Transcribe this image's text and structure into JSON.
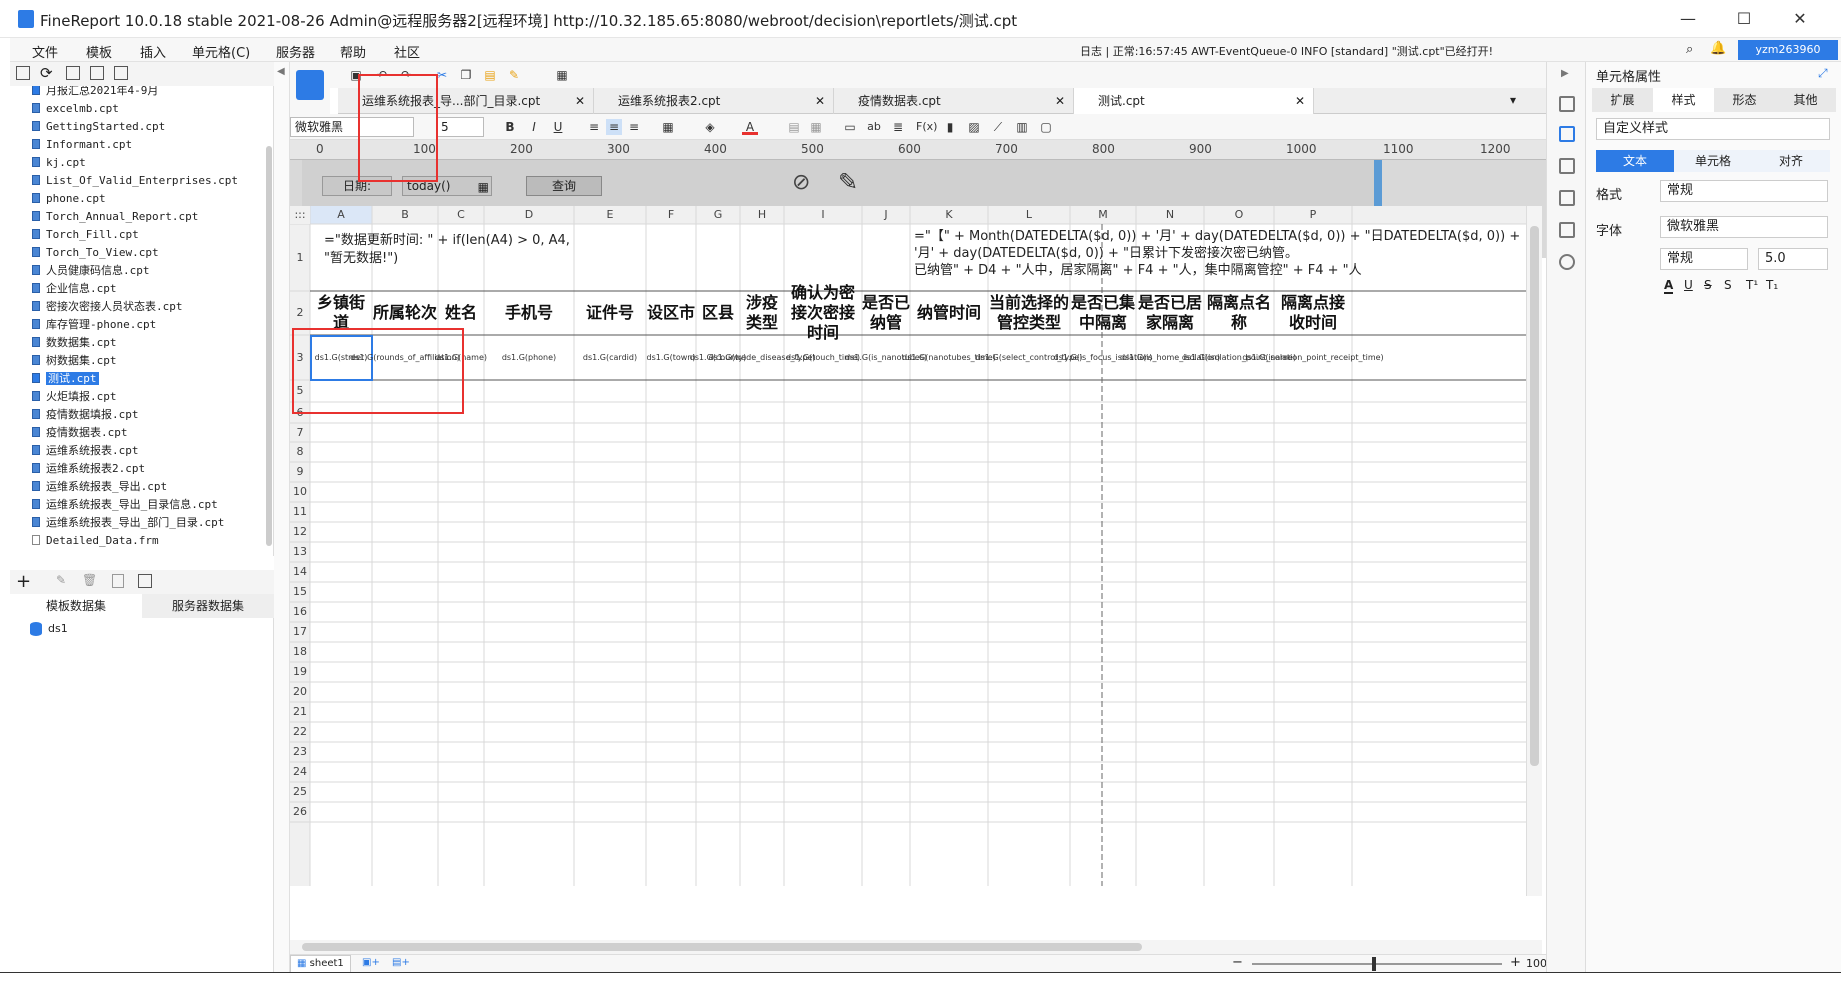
{
  "window": {
    "title": "FineReport 10.0.18 stable 2021-08-26 Admin@远程服务器2[远程环境]   http://10.32.185.65:8080/webroot/decision\\reportlets/测试.cpt",
    "min": "—",
    "max": "☐",
    "close": "✕"
  },
  "menu": [
    "文件",
    "模板",
    "插入",
    "单元格(C)",
    "服务器",
    "帮助",
    "社区"
  ],
  "log_text": "日志 | 正常:16:57:45 AWT-EventQueue-0 INFO [standard] \"测试.cpt\"已经打开!",
  "user": "yzm263960",
  "tree": {
    "items": [
      "月报汇总2021年4-9月",
      "excelmb.cpt",
      "GettingStarted.cpt",
      "Informant.cpt",
      "kj.cpt",
      "List_Of_Valid_Enterprises.cpt",
      "phone.cpt",
      "Torch_Annual_Report.cpt",
      "Torch_Fill.cpt",
      "Torch_To_View.cpt",
      "人员健康码信息.cpt",
      "企业信息.cpt",
      "密接次密接人员状态表.cpt",
      "库存管理-phone.cpt",
      "数数据集.cpt",
      "树数据集.cpt",
      "测试.cpt",
      "火炬填报.cpt",
      "疫情数据填报.cpt",
      "疫情数据表.cpt",
      "运维系统报表.cpt",
      "运维系统报表2.cpt",
      "运维系统报表_导出.cpt",
      "运维系统报表_导出_目录信息.cpt",
      "运维系统报表_导出_部门_目录.cpt",
      "Detailed_Data.frm"
    ],
    "selected": 16
  },
  "datasets": {
    "tab_template": "模板数据集",
    "tab_server": "服务器数据集",
    "items": [
      "ds1"
    ]
  },
  "tabs": [
    {
      "label": "运维系统报表_导...部门_目录.cpt"
    },
    {
      "label": "运维系统报表2.cpt"
    },
    {
      "label": "疫情数据表.cpt"
    },
    {
      "label": "测试.cpt"
    }
  ],
  "format": {
    "font": "微软雅黑",
    "size": "5"
  },
  "ruler": [
    "0",
    "100",
    "200",
    "300",
    "400",
    "500",
    "600",
    "700",
    "800",
    "900",
    "1000",
    "1100",
    "1200"
  ],
  "param": {
    "date_label": "日期:",
    "date_value": "today()",
    "query": "查询"
  },
  "columns": [
    "A",
    "B",
    "C",
    "D",
    "E",
    "F",
    "G",
    "H",
    "I",
    "J",
    "K",
    "L",
    "M",
    "N",
    "O",
    "P"
  ],
  "rows": [
    "1",
    "2",
    "3",
    "5",
    "6",
    "7",
    "8",
    "9",
    "10",
    "11",
    "12",
    "13",
    "14",
    "15",
    "16",
    "17",
    "18",
    "19",
    "20",
    "21",
    "22",
    "23",
    "24",
    "25",
    "26"
  ],
  "row1": {
    "a": "=\"数据更新时间: \" + if(len(A4) > 0, A4, \"暂无数据!\")",
    "k": "=\"【\" + Month(DATEDELTA($d, 0)) + '月' + day(DATEDELTA($d, 0)) + \"日DATEDELTA($d, 0)) + '月' + day(DATEDELTA($d, 0)) + \"日累计下发密接次密已纳管。\n已纳管\" + D4 + \"人中，居家隔离\" + F4 + \"人，集中隔离管控\" + F4 + \"人"
  },
  "headers": [
    "乡镇街道",
    "所属轮次",
    "姓名",
    "手机号",
    "证件号",
    "设区市",
    "区县",
    "涉疫类型",
    "确认为密接次密接时间",
    "是否已纳管",
    "纳管时间",
    "当前选择的管控类型",
    "是否已集中隔离",
    "是否已居家隔离",
    "隔离点名称",
    "隔离点接收时间"
  ],
  "cells": [
    "ds1.G(street)",
    "ds1.G(rounds_of_affiliation)",
    "ds1.G(name)",
    "ds1.G(phone)",
    "ds1.G(cardid)",
    "ds1.G(town)",
    "ds1.G(county)",
    "ds1.G(wade_disease_type)",
    "ds1.G(touch_time)",
    "ds1.G(is_nanotubes)",
    "ds1.G(nanotubes_time)",
    "ds1.G(select_control_type)",
    "ds1.G(is_focus_isolation)",
    "ds1.G(is_home_isolation)",
    "ds1.G(isolation_point_name)",
    "ds1.G(isolation_point_receipt_time)"
  ],
  "status": {
    "sheet": "sheet1",
    "zoom": "100",
    "zoom_pct": "%"
  },
  "right": {
    "title": "单元格属性",
    "tabs": [
      "扩展",
      "样式",
      "形态",
      "其他"
    ],
    "style_type": "自定义样式",
    "subtabs": [
      "文本",
      "单元格",
      "对齐"
    ],
    "format_label": "格式",
    "format_value": "常规",
    "font_label": "字体",
    "font_value": "微软雅黑",
    "font_style": "常规",
    "font_size": "5.0"
  },
  "accent": "#2d7be5",
  "highlight": "#e8312f"
}
